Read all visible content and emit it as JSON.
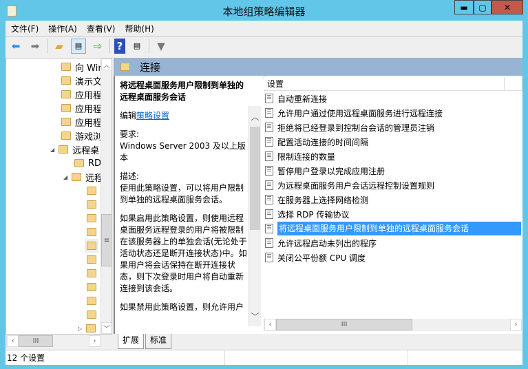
{
  "window": {
    "title": "本地组策略编辑器",
    "minimize": "▬",
    "maximize": "▢",
    "close": "✕",
    "close_color": "#c1594f"
  },
  "menu": [
    "文件(F)",
    "操作(A)",
    "查看(V)",
    "帮助(H)"
  ],
  "tree": {
    "items": [
      "向 Wir",
      "演示文",
      "应用程",
      "应用程",
      "应用程",
      "游戏浏",
      "远程桌",
      "RD",
      "远程"
    ]
  },
  "header": {
    "title": "连接"
  },
  "description": {
    "title": "将远程桌面服务用户限制到单独的远程桌面服务会话",
    "edit_prefix": "编辑",
    "edit_link": "策略设置",
    "req_label": "要求:",
    "req_value": "Windows Server 2003 及以上版本",
    "desc_label": "描述:",
    "p1": "使用此策略设置，可以将用户限制到单独的远程桌面服务会话。",
    "p2": "如果启用此策略设置，则使用远程桌面服务远程登录的用户将被限制在该服务器上的单独会话(无论处于活动状态还是断开连接状态)中。如果用户将会话保持在断开连接状态，则下次登录时用户将自动重新连接到该会话。",
    "p3": "如果禁用此策略设置，则允许用户"
  },
  "list": {
    "column": "设置",
    "rows": [
      "自动重新连接",
      "允许用户通过使用远程桌面服务进行远程连接",
      "拒绝将已经登录到控制台会话的管理员注销",
      "配置活动连接的时间间隔",
      "限制连接的数量",
      "暂停用户登录以完成应用注册",
      "为远程桌面服务用户会话远程控制设置规则",
      "在服务器上选择网络检测",
      "选择 RDP 传输协议",
      "将远程桌面服务用户限制到单独的远程桌面服务会话",
      "允许远程启动未列出的程序",
      "关闭公平份额 CPU 调度"
    ],
    "selected_index": 9
  },
  "tabs": [
    "扩展",
    "标准"
  ],
  "status": "12 个设置"
}
